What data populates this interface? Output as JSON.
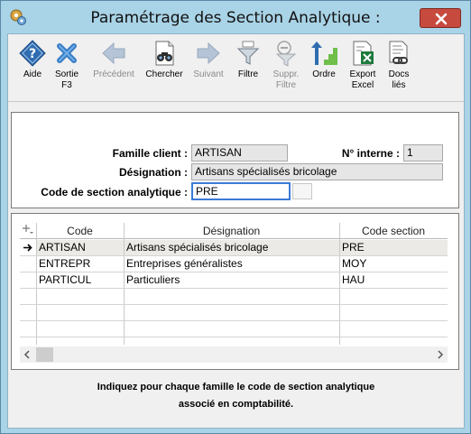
{
  "window": {
    "title": "Paramétrage des Section Analytique :"
  },
  "toolbar": {
    "items": [
      {
        "label": "Aide",
        "icon": "help-diamond-icon",
        "enabled": true
      },
      {
        "label": "Sortie\nF3",
        "icon": "exit-x-icon",
        "enabled": true
      },
      {
        "label": "Précédent",
        "icon": "arrow-left-icon",
        "enabled": false
      },
      {
        "label": "Chercher",
        "icon": "binoculars-document-icon",
        "enabled": true
      },
      {
        "label": "Suivant",
        "icon": "arrow-right-icon",
        "enabled": false
      },
      {
        "label": "Filtre",
        "icon": "funnel-icon",
        "enabled": true
      },
      {
        "label": "Suppr.\nFiltre",
        "icon": "remove-filter-icon",
        "enabled": false
      },
      {
        "label": "Ordre",
        "icon": "sort-order-icon",
        "enabled": true
      },
      {
        "label": "Export\nExcel",
        "icon": "excel-export-icon",
        "enabled": true
      },
      {
        "label": "Docs\nliés",
        "icon": "linked-docs-icon",
        "enabled": true
      }
    ]
  },
  "form": {
    "famille_label": "Famille client :",
    "famille_value": "ARTISAN",
    "interne_label": "N° interne :",
    "interne_value": "1",
    "designation_label": "Désignation :",
    "designation_value": "Artisans spécialisés bricolage",
    "code_label": "Code de section analytique :",
    "code_value": "PRE"
  },
  "grid": {
    "columns": [
      "Code",
      "Désignation",
      "Code section"
    ],
    "rows": [
      {
        "code": "ARTISAN",
        "designation": "Artisans spécialisés bricolage",
        "section": "PRE",
        "selected": true
      },
      {
        "code": "ENTREPR",
        "designation": "Entreprises généralistes",
        "section": "MOY",
        "selected": false
      },
      {
        "code": "PARTICUL",
        "designation": "Particuliers",
        "section": "HAU",
        "selected": false
      }
    ]
  },
  "help": {
    "line1": "Indiquez pour chaque famille le code de section analytique",
    "line2": "associé en comptabilité."
  },
  "colors": {
    "window_frame": "#a9d3e6",
    "close_button": "#c74a3f",
    "input_focus": "#3b7bd6",
    "icon_blue": "#2f6db0"
  }
}
